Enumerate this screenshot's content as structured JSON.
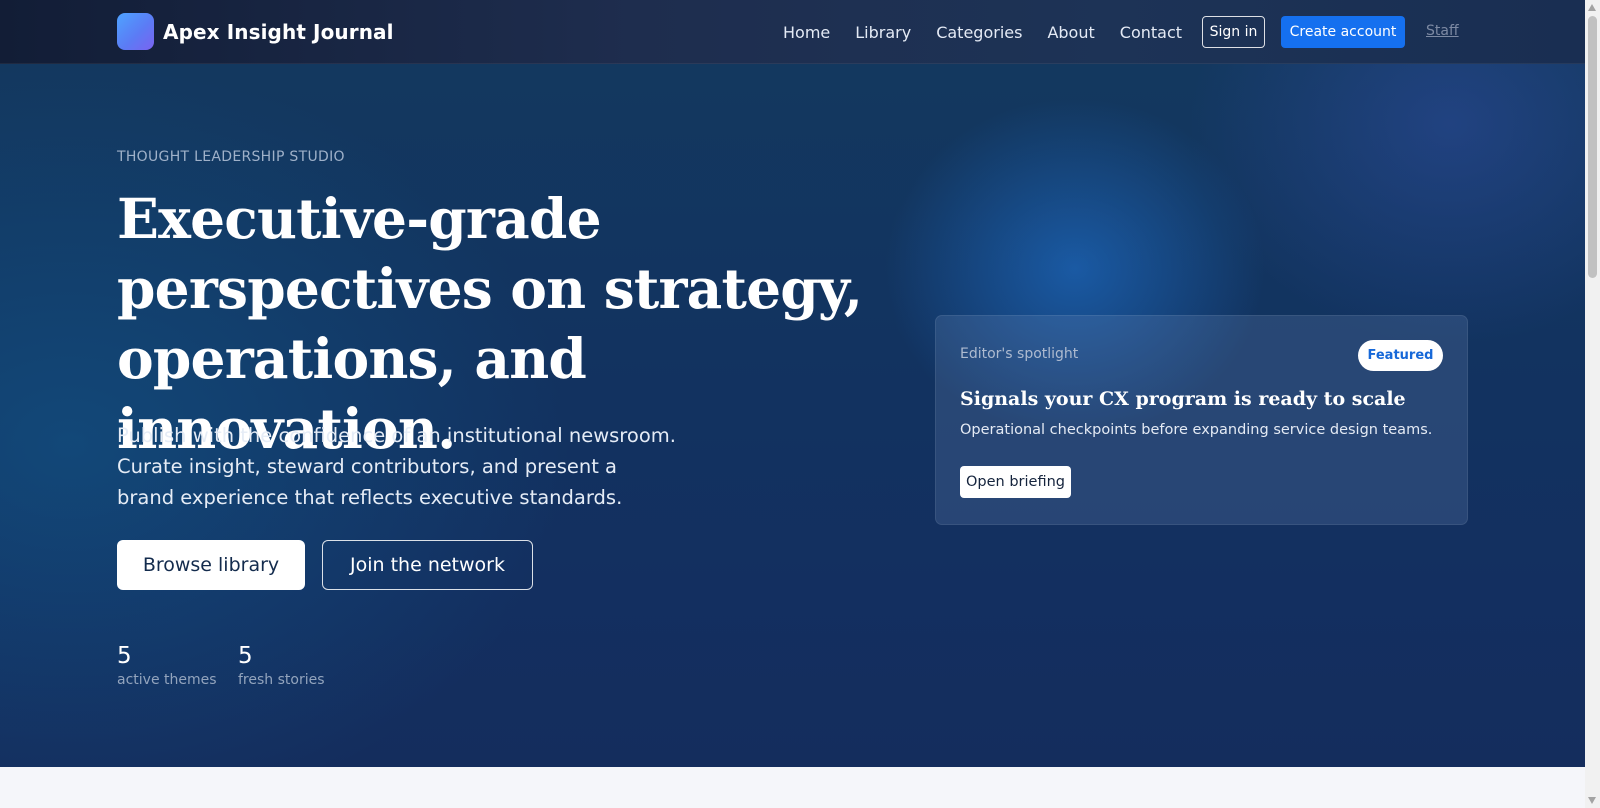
{
  "brand": {
    "name": "Apex Insight Journal",
    "logo_icon": "app-logo-icon"
  },
  "nav": {
    "links": [
      "Home",
      "Library",
      "Categories",
      "About",
      "Contact"
    ],
    "signin_label": "Sign in",
    "create_label": "Create account",
    "staff_label": "Staff"
  },
  "hero": {
    "eyebrow": "THOUGHT LEADERSHIP STUDIO",
    "headline": "Executive-grade perspectives on strategy, operations, and innovation.",
    "lede": "Publish with the confidence of an institutional newsroom. Curate insight, steward contributors, and present a brand experience that reflects executive standards.",
    "browse_label": "Browse library",
    "join_label": "Join the network",
    "stats": [
      {
        "value": "5",
        "label": "active themes"
      },
      {
        "value": "5",
        "label": "fresh stories"
      }
    ]
  },
  "spotlight": {
    "label": "Editor's spotlight",
    "badge": "Featured",
    "title": "Signals your CX program is ready to scale",
    "description": "Operational checkpoints before expanding service design teams.",
    "button_label": "Open briefing"
  },
  "colors": {
    "accent": "#1570ef",
    "hero_bg": "#132f60",
    "nav_bg": "#1e2d4e",
    "badge_text": "#1668d8"
  }
}
